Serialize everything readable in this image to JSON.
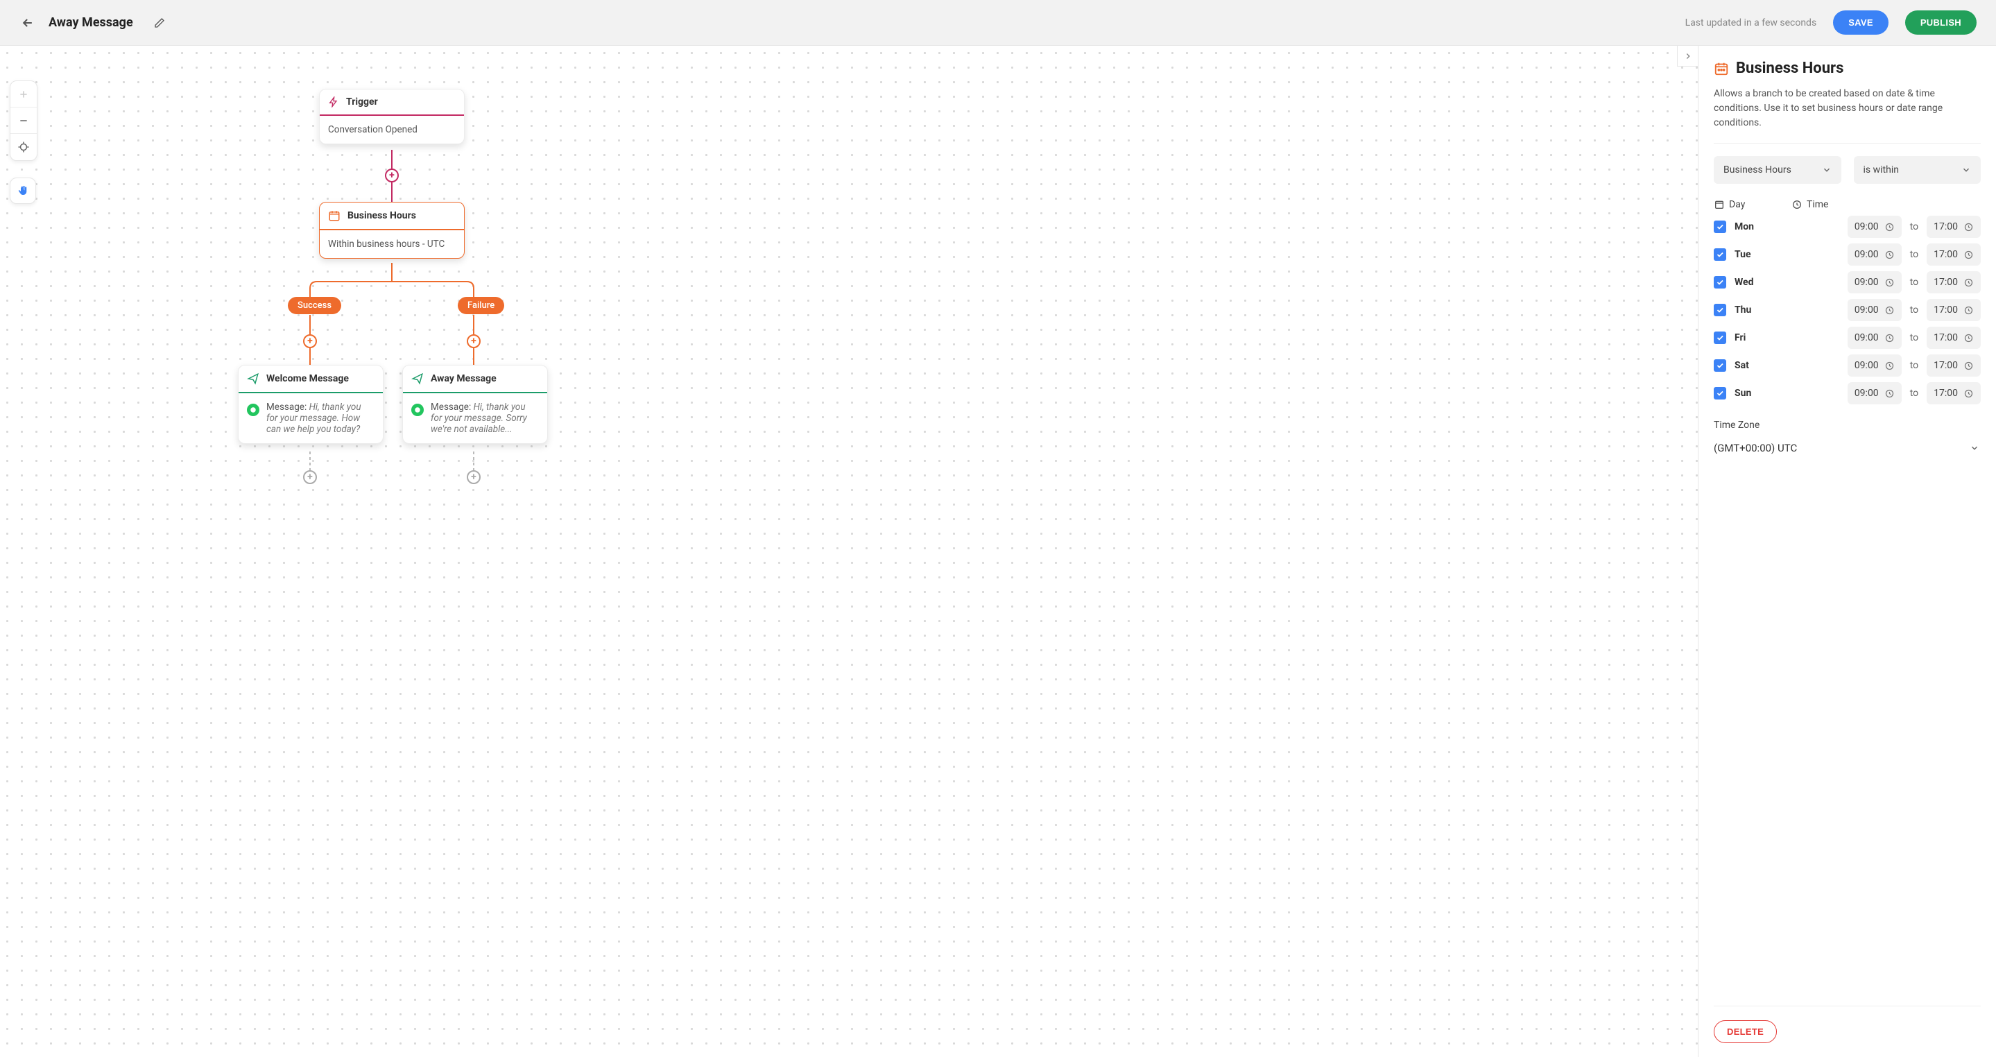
{
  "header": {
    "title": "Away Message",
    "last_updated": "Last updated in a few seconds",
    "save": "SAVE",
    "publish": "PUBLISH"
  },
  "flow": {
    "trigger": {
      "title": "Trigger",
      "body": "Conversation Opened",
      "accent": "#c32a63"
    },
    "business_hours": {
      "title": "Business Hours",
      "body": "Within business hours - UTC",
      "accent": "#ee6b2c"
    },
    "branches": {
      "success": "Success",
      "failure": "Failure"
    },
    "welcome": {
      "title": "Welcome Message",
      "prefix": "Message: ",
      "body_italic": "Hi, thank you for your message. How can we help you today?"
    },
    "away": {
      "title": "Away Message",
      "prefix": "Message: ",
      "body_italic": "Hi, thank you for your message. Sorry we're not available..."
    }
  },
  "sidebar": {
    "title": "Business Hours",
    "description": "Allows a branch to be created based on date & time conditions. Use it to set business hours or date range conditions.",
    "select_type": "Business Hours",
    "select_cond": "is within",
    "col_day": "Day",
    "col_time": "Time",
    "to": "to",
    "days": [
      {
        "label": "Mon",
        "checked": true,
        "start": "09:00",
        "end": "17:00"
      },
      {
        "label": "Tue",
        "checked": true,
        "start": "09:00",
        "end": "17:00"
      },
      {
        "label": "Wed",
        "checked": true,
        "start": "09:00",
        "end": "17:00"
      },
      {
        "label": "Thu",
        "checked": true,
        "start": "09:00",
        "end": "17:00"
      },
      {
        "label": "Fri",
        "checked": true,
        "start": "09:00",
        "end": "17:00"
      },
      {
        "label": "Sat",
        "checked": true,
        "start": "09:00",
        "end": "17:00"
      },
      {
        "label": "Sun",
        "checked": true,
        "start": "09:00",
        "end": "17:00"
      }
    ],
    "tz_label": "Time Zone",
    "tz_value": "(GMT+00:00) UTC",
    "delete": "DELETE"
  }
}
